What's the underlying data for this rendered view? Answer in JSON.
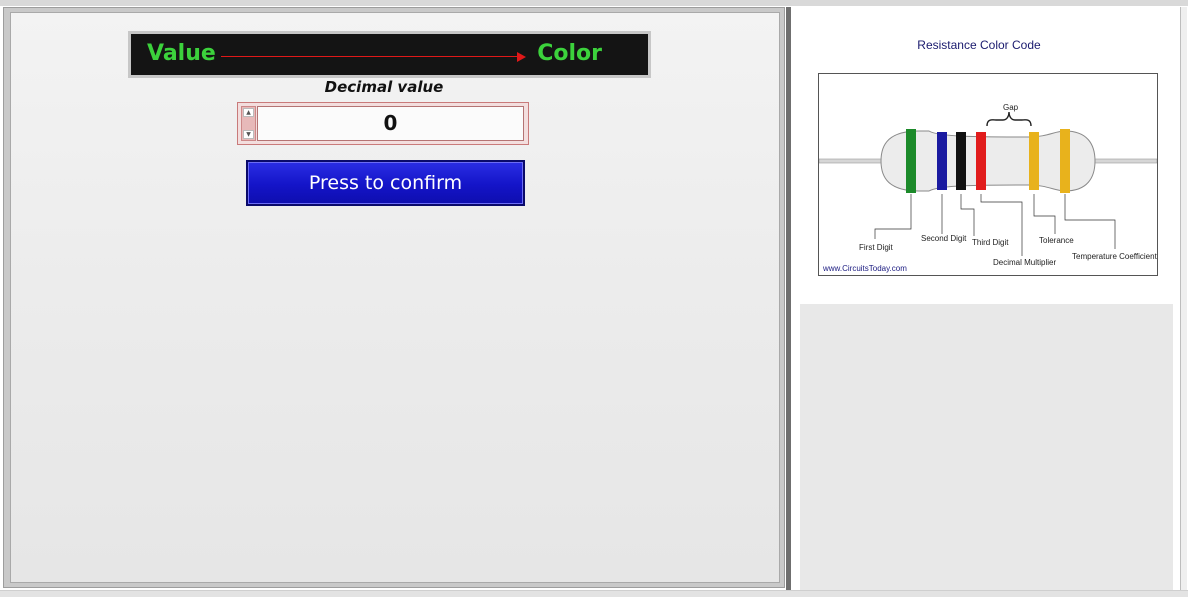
{
  "converter": {
    "banner_left": "Value",
    "banner_right": "Color",
    "input_label": "Decimal value",
    "input_value": "0",
    "confirm_button": "Press to confirm"
  },
  "reference": {
    "title": "Resistance Color Code",
    "labels": {
      "gap": "Gap",
      "first_digit": "First Digit",
      "second_digit": "Second Digit",
      "third_digit": "Third Digit",
      "decimal_multiplier": "Decimal Multiplier",
      "tolerance": "Tolerance",
      "temp_coeff": "Temperature Coefficient"
    },
    "credit": "www.CircuitsToday.com",
    "band_colors": [
      "#1c8a2a",
      "#1a1aa0",
      "#111111",
      "#e11c1c",
      "#e8b21c",
      "#e8b21c"
    ]
  },
  "colors": {
    "banner_text": "#3cd23c",
    "arrow": "#e01818",
    "button_bg": "#1414c8"
  }
}
